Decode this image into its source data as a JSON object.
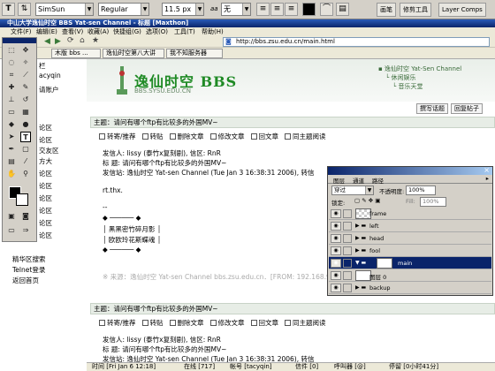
{
  "ps_options": {
    "font": "SimSun",
    "style": "Regular",
    "size": "11.5 px",
    "aa": "无",
    "aa_prefix": "aa",
    "tabs": [
      "画笔",
      "修剪工具",
      "Layer Comps"
    ]
  },
  "browser": {
    "title": "中山大学逸仙时空 BBS Yat-sen Channel - 标题 [Maxthon]",
    "menus": [
      "文件(F)",
      "编辑(E)",
      "查看(V)",
      "收藏(A)",
      "快捷组(G)",
      "选项(O)",
      "工具(T)",
      "帮助(H)"
    ],
    "address": "http://bbs.zsu.edu.cn/main.html",
    "tabs": [
      "木版 bbs ...",
      "逸仙时空第八大讲",
      "我不知服务器"
    ]
  },
  "forum": {
    "logo": "逸仙时空 BBS",
    "logo_sub": "BBS.SYSU.EDU.CN",
    "tree": [
      "逸仙时空 Yat-Sen Channel",
      "休闲娱乐",
      "音乐天堂"
    ],
    "buttons": [
      "撰写话题",
      "回复帖子"
    ],
    "actions": [
      "转寄/推荐",
      "转贴",
      "删除文章",
      "修改文章",
      "回文章",
      "同主题阅读"
    ],
    "posts": [
      {
        "subject": "主题：请问有哪个ftp有比较多的外国MV~",
        "lines": [
          "发信人: lissy (泰竹x复刻剧), 信区: RnR",
          "标  题: 请问有哪个ftp有比较多的外国MV~",
          "发信站: 逸仙时空 Yat-sen Channel (Tue Jan  3 16:38:31 2006), 转信",
          "rt.thx."
        ],
        "sig": [
          "--",
          "◆ ────── ◆",
          "│ 黑黑密竹碎月影 │",
          "│ 欧欧玲花斯蝶魂 │",
          "◆ ────── ◆"
        ],
        "footer": "※ 来源：逸仙时空 Yat-sen Channel bbs.zsu.edu.cn．[FROM: 192.168.90.100]"
      },
      {
        "subject": "主题：请问有哪个ftp有比较多的外国MV~",
        "lines": [
          "发信人: lissy (泰竹x复刻剧), 信区: RnR",
          "标  题: 请问有哪个ftp有比较多的外国MV~",
          "发信站: 逸仙时空 Yat-sen Channel (Tue Jan  3 16:38:31 2006), 转信",
          "rt.thx."
        ]
      }
    ]
  },
  "sidebar": {
    "items": [
      "栏",
      "acyqin",
      "请账户",
      "论区",
      "论区",
      "交友区",
      "方大",
      "论区",
      "论区",
      "论区",
      "论区",
      "论区",
      "论区",
      "论区"
    ],
    "low": [
      "精华区搜索",
      "Telnet登录",
      "返回首页"
    ]
  },
  "status": {
    "items": [
      "时间 [Fri Jan 6 12:18]",
      "在线 [717]",
      "帐号 [tacyqin]",
      "信件 [0]",
      "呼叫器 [@]",
      "停留 [0小时41分]"
    ]
  },
  "layers": {
    "tabs": [
      "图层",
      "通道",
      "路径"
    ],
    "blend": "穿过",
    "opacity_label": "不透明度:",
    "opacity": "100%",
    "lock_label": "锁定:",
    "fill_label": "Fill:",
    "fill": "100%",
    "rows": [
      {
        "name": "frame",
        "type": "layer"
      },
      {
        "name": "left",
        "type": "folder"
      },
      {
        "name": "head",
        "type": "folder"
      },
      {
        "name": "fool",
        "type": "folder"
      },
      {
        "name": "main",
        "type": "folder-selected"
      },
      {
        "name": "图层 0",
        "type": "layer"
      },
      {
        "name": "backup",
        "type": "folder"
      }
    ]
  },
  "colors": {
    "brand_green": "#1f8a25",
    "title_blue": "#0a246a",
    "selected_layer": "#0a246a"
  }
}
